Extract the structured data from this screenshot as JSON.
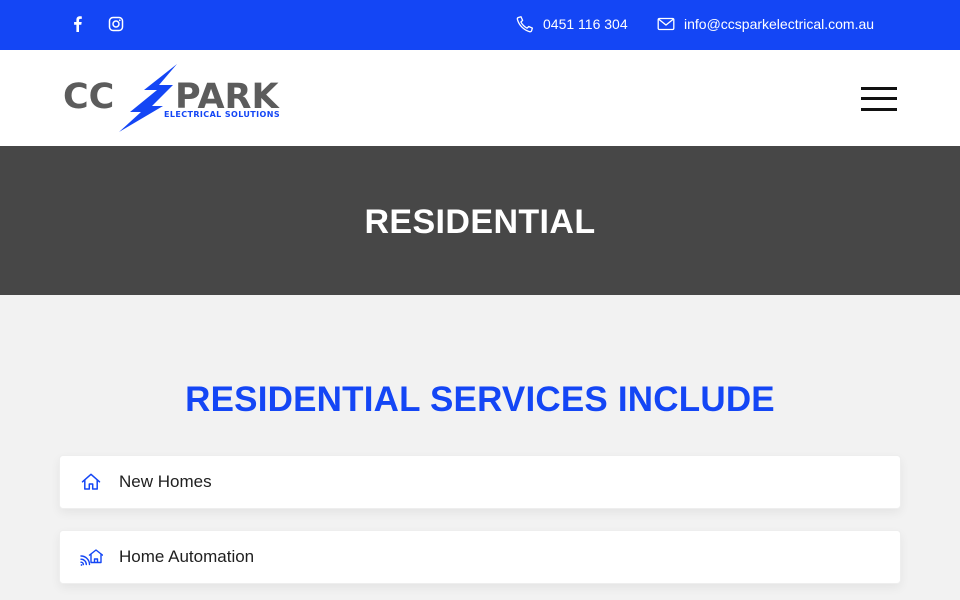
{
  "topbar": {
    "social": [
      {
        "icon": "facebook-icon"
      },
      {
        "icon": "instagram-icon"
      }
    ],
    "phone": "0451 116 304",
    "email": "info@ccsparkelectrical.com.au",
    "phone_icon": "phone-icon",
    "email_icon": "envelope-icon",
    "background": "#1446f5"
  },
  "header": {
    "logo": {
      "text_left": "CC",
      "text_right": "PARK",
      "subtitle": "ELECTRICAL SOLUTIONS"
    },
    "menu_icon": "hamburger-menu-icon"
  },
  "banner": {
    "title": "RESIDENTIAL",
    "background": "#474747"
  },
  "main": {
    "section_title": "RESIDENTIAL SERVICES INCLUDE",
    "accent": "#1446f5",
    "services": [
      {
        "label": "New Homes",
        "icon": "house-icon"
      },
      {
        "label": "Home Automation",
        "icon": "smart-home-icon"
      }
    ]
  }
}
